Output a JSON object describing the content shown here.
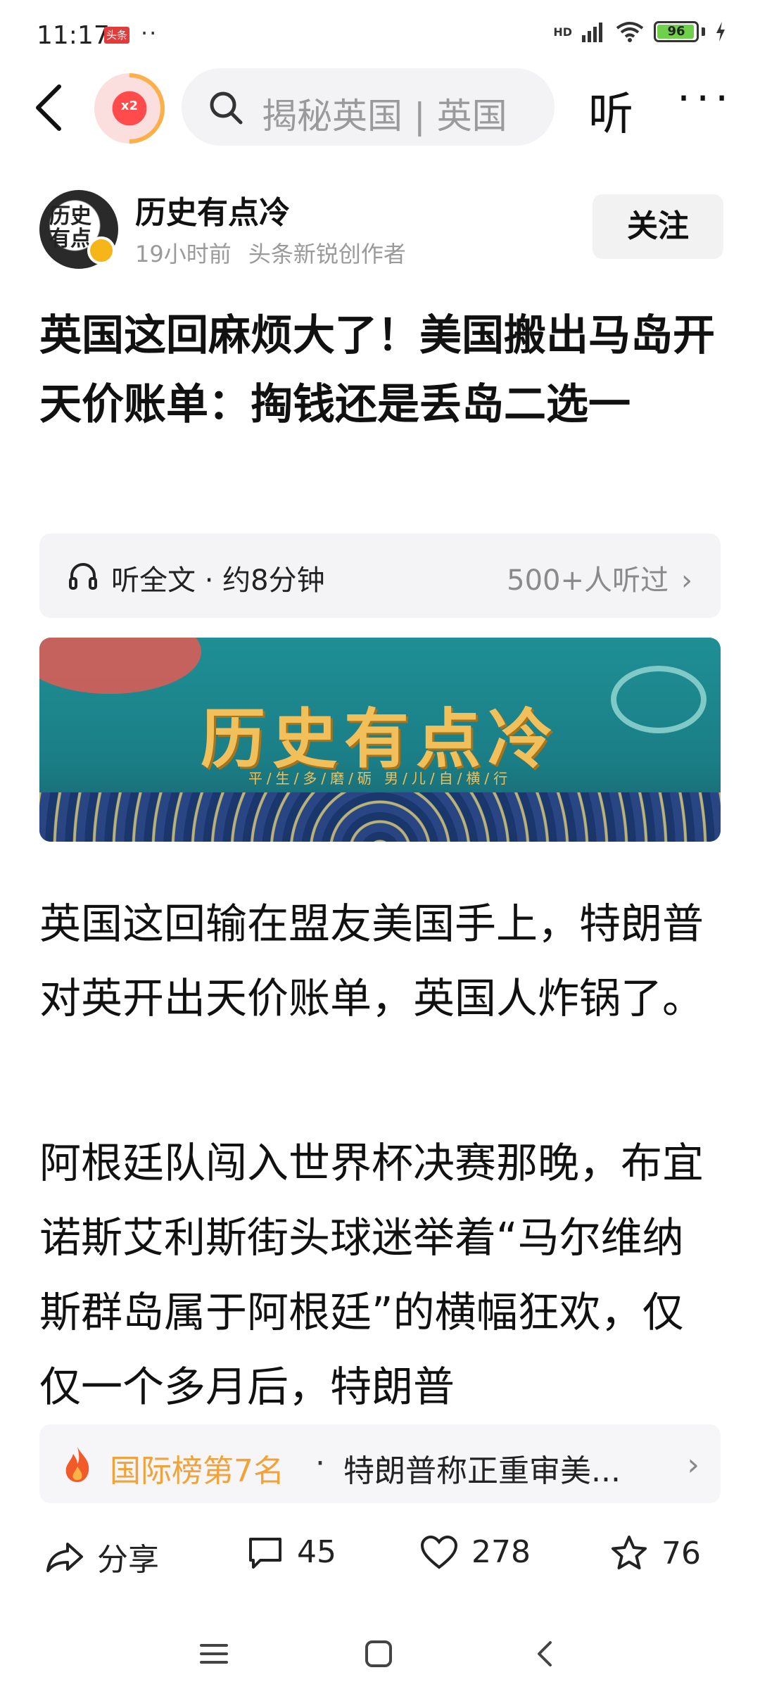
{
  "status_bar": {
    "time": "11:17",
    "app_badge": "头条",
    "dots": "··",
    "network": "HD",
    "battery": "96",
    "battery_level": 0.96
  },
  "top_nav": {
    "badge_text": "x2",
    "search_placeholder": "揭秘英国 | 英国",
    "listen_label": "听",
    "more_label": "···"
  },
  "author": {
    "name": "历史有点冷",
    "avatar_text": "历史有点",
    "time_ago": "19小时前",
    "tag": "头条新锐创作者",
    "follow_label": "关注"
  },
  "article": {
    "title": "英国这回麻烦大了！美国搬出马岛开天价账单：掏钱还是丢岛二选一",
    "listen_bar": {
      "label": "听全文 · 约8分钟",
      "listeners": "500+人听过"
    },
    "banner": {
      "title": "历史有点冷",
      "subtitle": "平/生/多/磨/砺 男/儿/自/横/行"
    },
    "paragraphs": [
      "英国这回输在盟友美国手上，特朗普对英开出天价账单，英国人炸锅了。",
      "阿根廷队闯入世界杯决赛那晚，布宜诺斯艾利斯街头球迷举着“马尔维纳斯群岛属于阿根廷”的横幅狂欢，仅仅一个多月后，特朗普"
    ]
  },
  "trending": {
    "rank": "国际榜第7名",
    "separator": "·",
    "topic": "特朗普称正重审美..."
  },
  "actions": {
    "share": "分享",
    "comments": "45",
    "likes": "278",
    "favorites": "76"
  }
}
